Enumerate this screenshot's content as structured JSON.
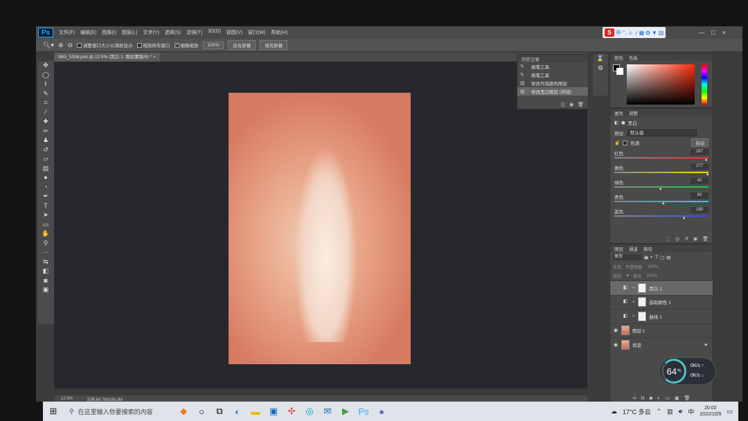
{
  "app": {
    "logo": "Ps",
    "menu": [
      "文件(F)",
      "编辑(E)",
      "图像(I)",
      "图层(L)",
      "文字(Y)",
      "选择(S)",
      "滤镜(T)",
      "3D(D)",
      "视图(V)",
      "窗口(W)",
      "帮助(H)"
    ]
  },
  "ime": {
    "logo": "S",
    "lang": "中",
    "icons": [
      "punct-icon",
      "emoji-icon",
      "mic-icon",
      "keyboard-icon",
      "skin-icon",
      "shirt-icon",
      "grid-icon"
    ]
  },
  "window_controls": {
    "minimize": "—",
    "restore": "□",
    "close": "×"
  },
  "options": {
    "resize_windows": "调整窗口大小以满屏显示",
    "zoom_all": "缩放所有窗口",
    "scrubby_zoom": "细微缩放",
    "btn_100": "100%",
    "btn_fit": "适合屏幕",
    "btn_fill": "填充屏幕"
  },
  "document": {
    "tab_title": "IMG_5338.psd @ 12.5% (黑白 1, 图层蒙版/8) * ×",
    "zoom": "12.5%",
    "doc_size": "文档:66.7M/166.3M"
  },
  "history": {
    "tabs": [
      "历史记录"
    ],
    "items": [
      {
        "label": "画笔工具",
        "icon": "brush-icon"
      },
      {
        "label": "画笔工具",
        "icon": "brush-icon"
      },
      {
        "label": "修改可选颜色图层",
        "icon": "doc-icon"
      },
      {
        "label": "修改黑白图层 (存储)",
        "icon": "doc-icon"
      }
    ]
  },
  "color": {
    "tabs": [
      "颜色",
      "色板"
    ],
    "accent": "#ff2a0a"
  },
  "properties": {
    "tabs": [
      "属性",
      "调整"
    ],
    "type": "黑白",
    "preset_label": "预设:",
    "preset_value": "默认值",
    "tint_label": "色调",
    "auto_label": "自动",
    "sliders": [
      {
        "label": "红色:",
        "value": "267",
        "pct": 0.975,
        "gradient": "linear-gradient(to right,#888,#ff2a2a)"
      },
      {
        "label": "黄色:",
        "value": "277",
        "pct": 0.99,
        "gradient": "linear-gradient(to right,#888,#ffe100)"
      },
      {
        "label": "绿色:",
        "value": "40",
        "pct": 0.49,
        "gradient": "linear-gradient(to right,#888,#18d23c)"
      },
      {
        "label": "青色:",
        "value": "60",
        "pct": 0.52,
        "gradient": "linear-gradient(to right,#888,#19d6e6)"
      },
      {
        "label": "蓝色:",
        "value": "180",
        "pct": 0.74,
        "gradient": "linear-gradient(to right,#888,#2a4bff)"
      }
    ]
  },
  "layers": {
    "tabs": [
      "图层",
      "通道",
      "路径"
    ],
    "filter": "类型",
    "blend": "正常",
    "opacity_label": "不透明度:",
    "opacity": "100%",
    "lock_label": "锁定:",
    "fill_label": "填充:",
    "fill": "100%",
    "items": [
      {
        "name": "黑白 1",
        "kind": "adjustment",
        "visible": false,
        "selected": true
      },
      {
        "name": "选取颜色 1",
        "kind": "adjustment",
        "visible": false,
        "selected": false
      },
      {
        "name": "曲线 1",
        "kind": "adjustment",
        "visible": false,
        "selected": false
      },
      {
        "name": "图层 1",
        "kind": "pixel",
        "visible": true,
        "selected": false
      },
      {
        "name": "背景",
        "kind": "pixel",
        "visible": true,
        "selected": false,
        "locked": true
      }
    ]
  },
  "meter": {
    "percent": "64",
    "unit": "%",
    "up": "0K/s",
    "down": "0K/s"
  },
  "taskbar": {
    "search_placeholder": "在这里输入你要搜索的内容",
    "weather": "17°C 多云",
    "time": "20:02",
    "date": "2022/10/5",
    "apps": [
      "cortana-icon",
      "task-view-icon",
      "edge-icon",
      "explorer-icon",
      "store-icon",
      "pinwheel-icon",
      "mail-icon",
      "player-icon",
      "photoshop-icon",
      "profile-icon"
    ]
  }
}
